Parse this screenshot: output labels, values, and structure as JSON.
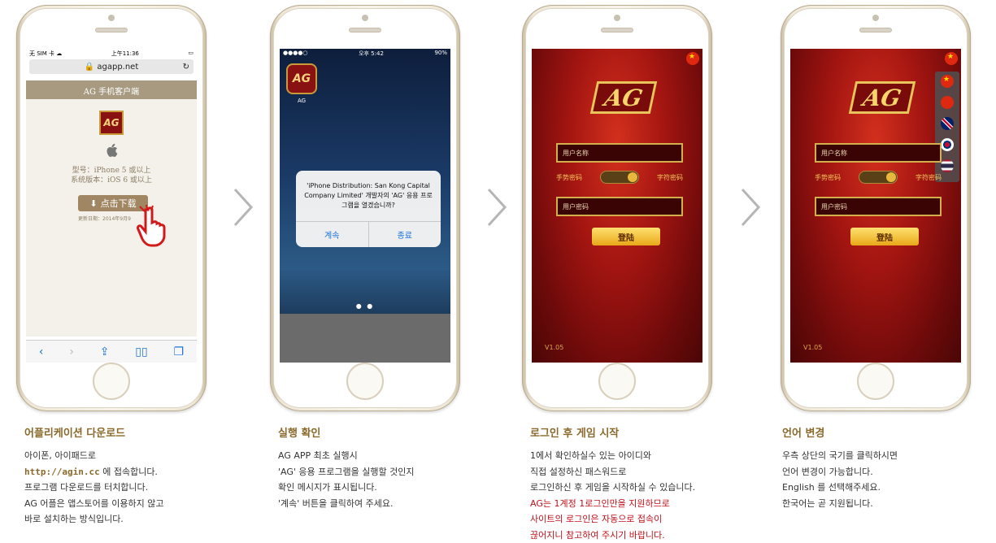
{
  "steps": [
    {
      "screen": {
        "status_left": "无 SIM 卡 ☁",
        "status_time": "上午11:36",
        "url": "🔒 agapp.net",
        "page_header": "AG 手机客户端",
        "logo": "AG",
        "model_line": "型号：iPhone 5 或以上",
        "version_line": "系统版本：iOS 6 或以上",
        "download_btn": "点击下载",
        "date_line": "更新日期：2014年9月9"
      },
      "title": "어플리케이션 다운로드",
      "lines": [
        "아이폰, 아이패드로",
        "http://agin.cc",
        "에 접속합니다.",
        "프로그램 다운로드를 터치합니다.",
        "AG 어플은 앱스토어를 이용하지 않고",
        "바로 설치하는 방식입니다."
      ]
    },
    {
      "screen": {
        "status_time": "오후 5:42",
        "battery": "90%",
        "icon": "AG",
        "icon_label": "AG",
        "alert_msg": "'iPhone Distribution: San Kong Capital Company Limited' 개발자의 'AG' 응용 프로그램을 열겠습니까?",
        "btn_continue": "계속",
        "btn_quit": "종료"
      },
      "title": "실행 확인",
      "lines": [
        "AG APP 최초 실행시",
        "'AG' 응용 프로그램을 실행할 것인지",
        "확인 메시지가 표시됩니다.",
        "'계속' 버튼을 클릭하여 주세요."
      ]
    },
    {
      "screen": {
        "logo": "AG",
        "username_placeholder": "用户名称",
        "toggle_left": "手势密码",
        "toggle_right": "字符密码",
        "password_placeholder": "用户密码",
        "login_btn": "登陆",
        "version": "V1.05"
      },
      "title": "로그인 후 게임 시작",
      "lines": [
        "1에서 확인하실수 있는 아이디와",
        "직접 설정하신 패스워드로",
        "로그인하신 후 게임을 시작하실 수 있습니다."
      ],
      "red_lines": [
        "AG는 1계정 1로그인만을 지원하므로",
        "사이트의 로그인은 자동으로 접속이",
        "끊어지니 참고하여 주시기 바랍니다."
      ]
    },
    {
      "screen": {
        "logo": "AG",
        "username_placeholder": "用户名称",
        "toggle_left": "手势密码",
        "toggle_right": "字符密码",
        "password_placeholder": "用户密码",
        "login_btn": "登陆",
        "version": "V1.05"
      },
      "title": "언어 변경",
      "lines": [
        "우측 상단의 국기를 클릭하시면",
        "언어 변경이 가능합니다.",
        "English 를 선택해주세요.",
        "한국어는 곧 지원됩니다."
      ]
    }
  ],
  "colors": {
    "caption_title": "#8a6a2c",
    "warning_red": "#c0101a",
    "link_blue": "#1a73d9"
  }
}
